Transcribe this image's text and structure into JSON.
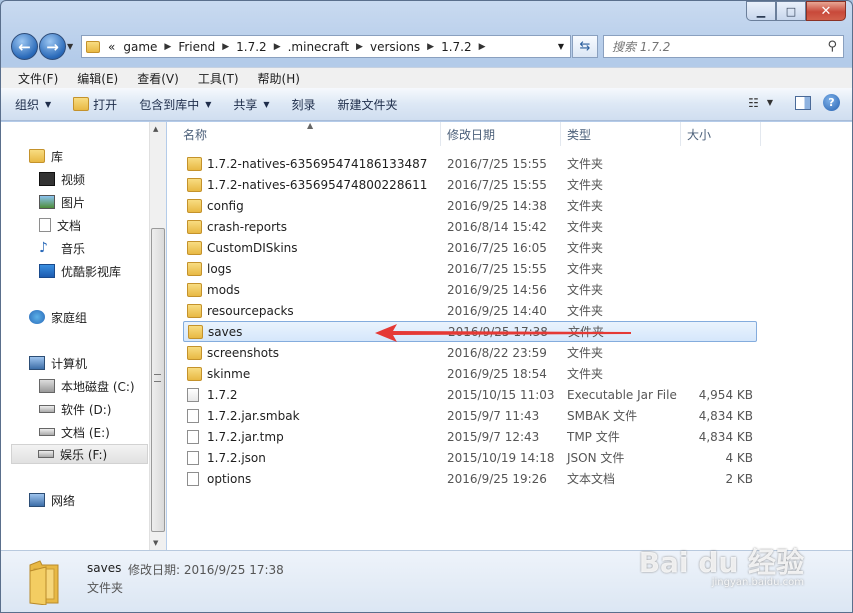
{
  "address": {
    "prefix": "«",
    "crumbs": [
      "game",
      "Friend",
      "1.7.2",
      ".minecraft",
      "versions",
      "1.7.2"
    ]
  },
  "search": {
    "placeholder": "搜索 1.7.2"
  },
  "menu": [
    "文件(F)",
    "编辑(E)",
    "查看(V)",
    "工具(T)",
    "帮助(H)"
  ],
  "toolbar": {
    "organize": "组织",
    "open": "打开",
    "include_in_library": "包含到库中",
    "share": "共享",
    "burn": "刻录",
    "new_folder": "新建文件夹"
  },
  "nav": {
    "libraries": "库",
    "videos": "视频",
    "pictures": "图片",
    "documents": "文档",
    "music": "音乐",
    "youku": "优酷影视库",
    "homegroup": "家庭组",
    "computer": "计算机",
    "drive_c": "本地磁盘 (C:)",
    "drive_d": "软件 (D:)",
    "drive_e": "文档 (E:)",
    "drive_f": "娱乐 (F:)",
    "network": "网络"
  },
  "columns": {
    "name": "名称",
    "date": "修改日期",
    "type": "类型",
    "size": "大小"
  },
  "files": [
    {
      "name": "1.7.2-natives-635695474186133487",
      "date": "2016/7/25 15:55",
      "type": "文件夹",
      "size": "",
      "kind": "folder"
    },
    {
      "name": "1.7.2-natives-635695474800228611",
      "date": "2016/7/25 15:55",
      "type": "文件夹",
      "size": "",
      "kind": "folder"
    },
    {
      "name": "config",
      "date": "2016/9/25 14:38",
      "type": "文件夹",
      "size": "",
      "kind": "folder"
    },
    {
      "name": "crash-reports",
      "date": "2016/8/14 15:42",
      "type": "文件夹",
      "size": "",
      "kind": "folder"
    },
    {
      "name": "CustomDISkins",
      "date": "2016/7/25 16:05",
      "type": "文件夹",
      "size": "",
      "kind": "folder"
    },
    {
      "name": "logs",
      "date": "2016/7/25 15:55",
      "type": "文件夹",
      "size": "",
      "kind": "folder"
    },
    {
      "name": "mods",
      "date": "2016/9/25 14:56",
      "type": "文件夹",
      "size": "",
      "kind": "folder"
    },
    {
      "name": "resourcepacks",
      "date": "2016/9/25 14:40",
      "type": "文件夹",
      "size": "",
      "kind": "folder"
    },
    {
      "name": "saves",
      "date": "2016/9/25 17:38",
      "type": "文件夹",
      "size": "",
      "kind": "folder"
    },
    {
      "name": "screenshots",
      "date": "2016/8/22 23:59",
      "type": "文件夹",
      "size": "",
      "kind": "folder"
    },
    {
      "name": "skinme",
      "date": "2016/9/25 18:54",
      "type": "文件夹",
      "size": "",
      "kind": "folder"
    },
    {
      "name": "1.7.2",
      "date": "2015/10/15 11:03",
      "type": "Executable Jar File",
      "size": "4,954 KB",
      "kind": "jar"
    },
    {
      "name": "1.7.2.jar.smbak",
      "date": "2015/9/7 11:43",
      "type": "SMBAK 文件",
      "size": "4,834 KB",
      "kind": "file"
    },
    {
      "name": "1.7.2.jar.tmp",
      "date": "2015/9/7 12:43",
      "type": "TMP 文件",
      "size": "4,834 KB",
      "kind": "file"
    },
    {
      "name": "1.7.2.json",
      "date": "2015/10/19 14:18",
      "type": "JSON 文件",
      "size": "4 KB",
      "kind": "file"
    },
    {
      "name": "options",
      "date": "2016/9/25 19:26",
      "type": "文本文档",
      "size": "2 KB",
      "kind": "file"
    }
  ],
  "details": {
    "name": "saves",
    "modified": "修改日期: 2016/9/25 17:38",
    "type": "文件夹"
  },
  "watermark": {
    "main": "Bai du 经验",
    "sub": "jingyan.baidu.com"
  }
}
